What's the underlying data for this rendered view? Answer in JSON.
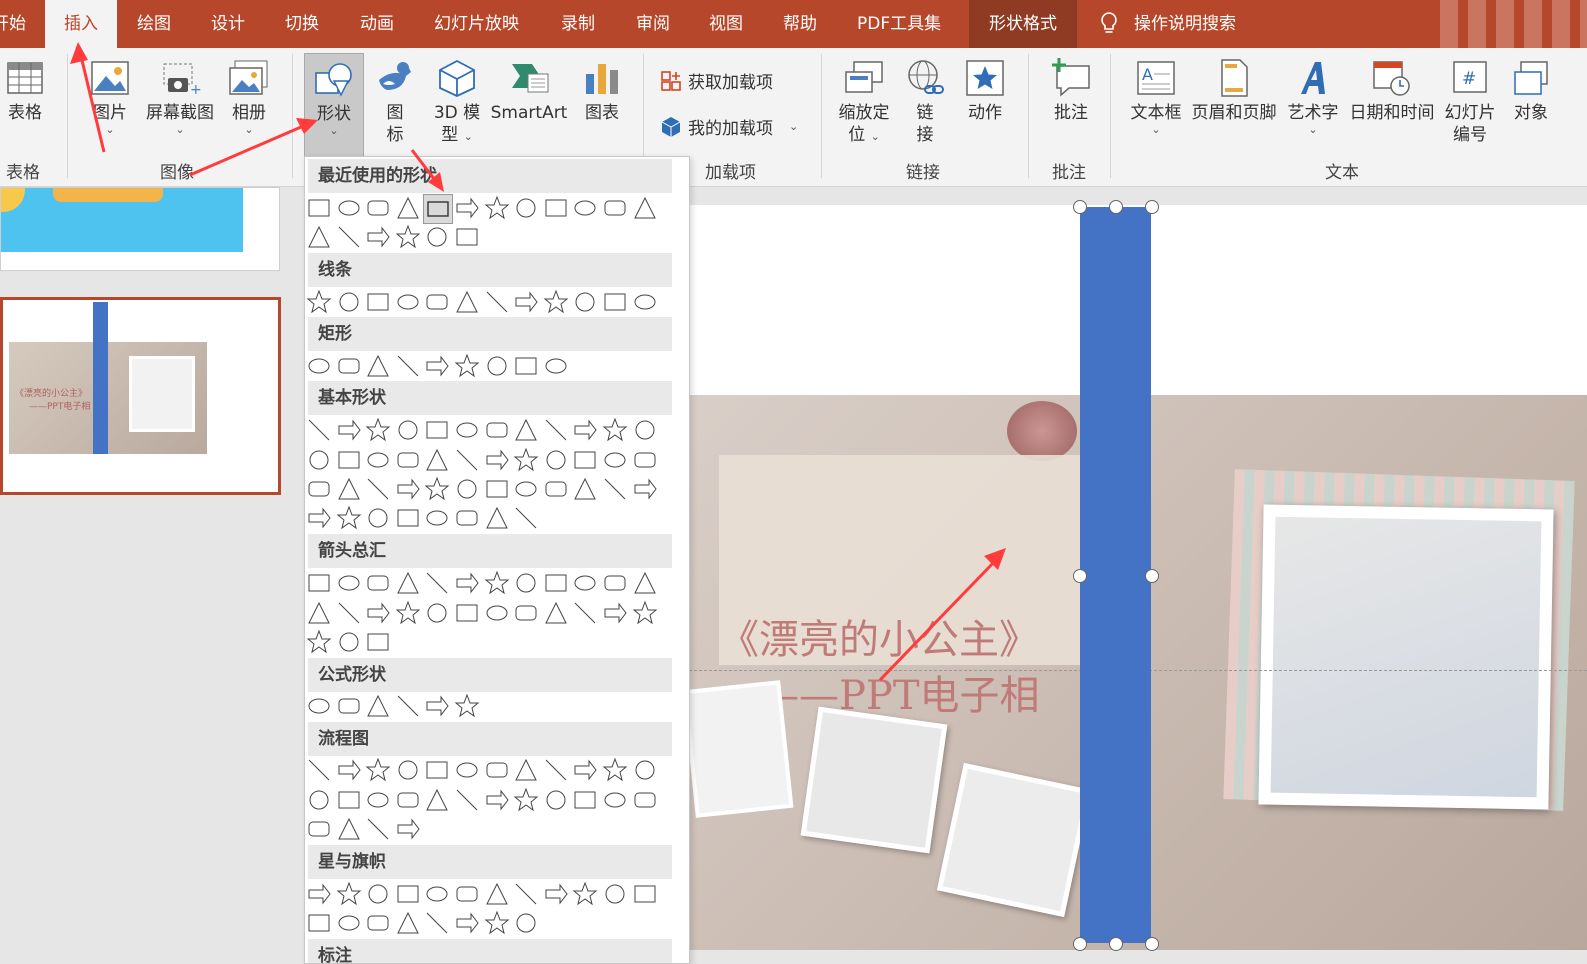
{
  "tabs": [
    "开始",
    "插入",
    "绘图",
    "设计",
    "切换",
    "动画",
    "幻灯片放映",
    "录制",
    "审阅",
    "视图",
    "帮助",
    "PDF工具集",
    "形状格式",
    "操作说明搜索"
  ],
  "ribbon": {
    "table": {
      "label": "表格",
      "group": "表格"
    },
    "picture": {
      "label": "图片"
    },
    "screenshot": {
      "label": "屏幕截图"
    },
    "album": {
      "label": "相册"
    },
    "image_group": "图像",
    "shapes": {
      "label": "形状"
    },
    "icons": {
      "label1": "图",
      "label2": "标"
    },
    "model3d": {
      "label1": "3D 模",
      "label2": "型"
    },
    "smartart": {
      "label": "SmartArt"
    },
    "chart": {
      "label": "图表"
    },
    "get_addins": "获取加载项",
    "my_addins": "我的加载项",
    "addins_group": "加载项",
    "zoom": {
      "label1": "缩放定",
      "label2": "位"
    },
    "link": {
      "label1": "链",
      "label2": "接"
    },
    "action": {
      "label": "动作"
    },
    "links_group": "链接",
    "comment": {
      "label": "批注",
      "group": "批注"
    },
    "textbox": {
      "label": "文本框"
    },
    "header_footer": {
      "label": "页眉和页脚"
    },
    "wordart": {
      "label": "艺术字"
    },
    "datetime": {
      "label": "日期和时间"
    },
    "slide_number": {
      "label1": "幻灯片",
      "label2": "编号"
    },
    "object": {
      "label": "对象"
    },
    "text_group": "文本"
  },
  "shapes_menu": {
    "sections": [
      "最近使用的形状",
      "线条",
      "矩形",
      "基本形状",
      "箭头总汇",
      "公式形状",
      "流程图",
      "星与旗帜",
      "标注"
    ]
  },
  "slide": {
    "title": "《漂亮的小公主》",
    "subtitle": "——PPT电子相"
  },
  "thumbnail": {
    "title": "《漂亮的小公主》",
    "subtitle": "——PPT电子相"
  },
  "colors": {
    "accent": "#b7472a",
    "shape_fill": "#4472c4",
    "arrow": "#ff3b3b"
  }
}
